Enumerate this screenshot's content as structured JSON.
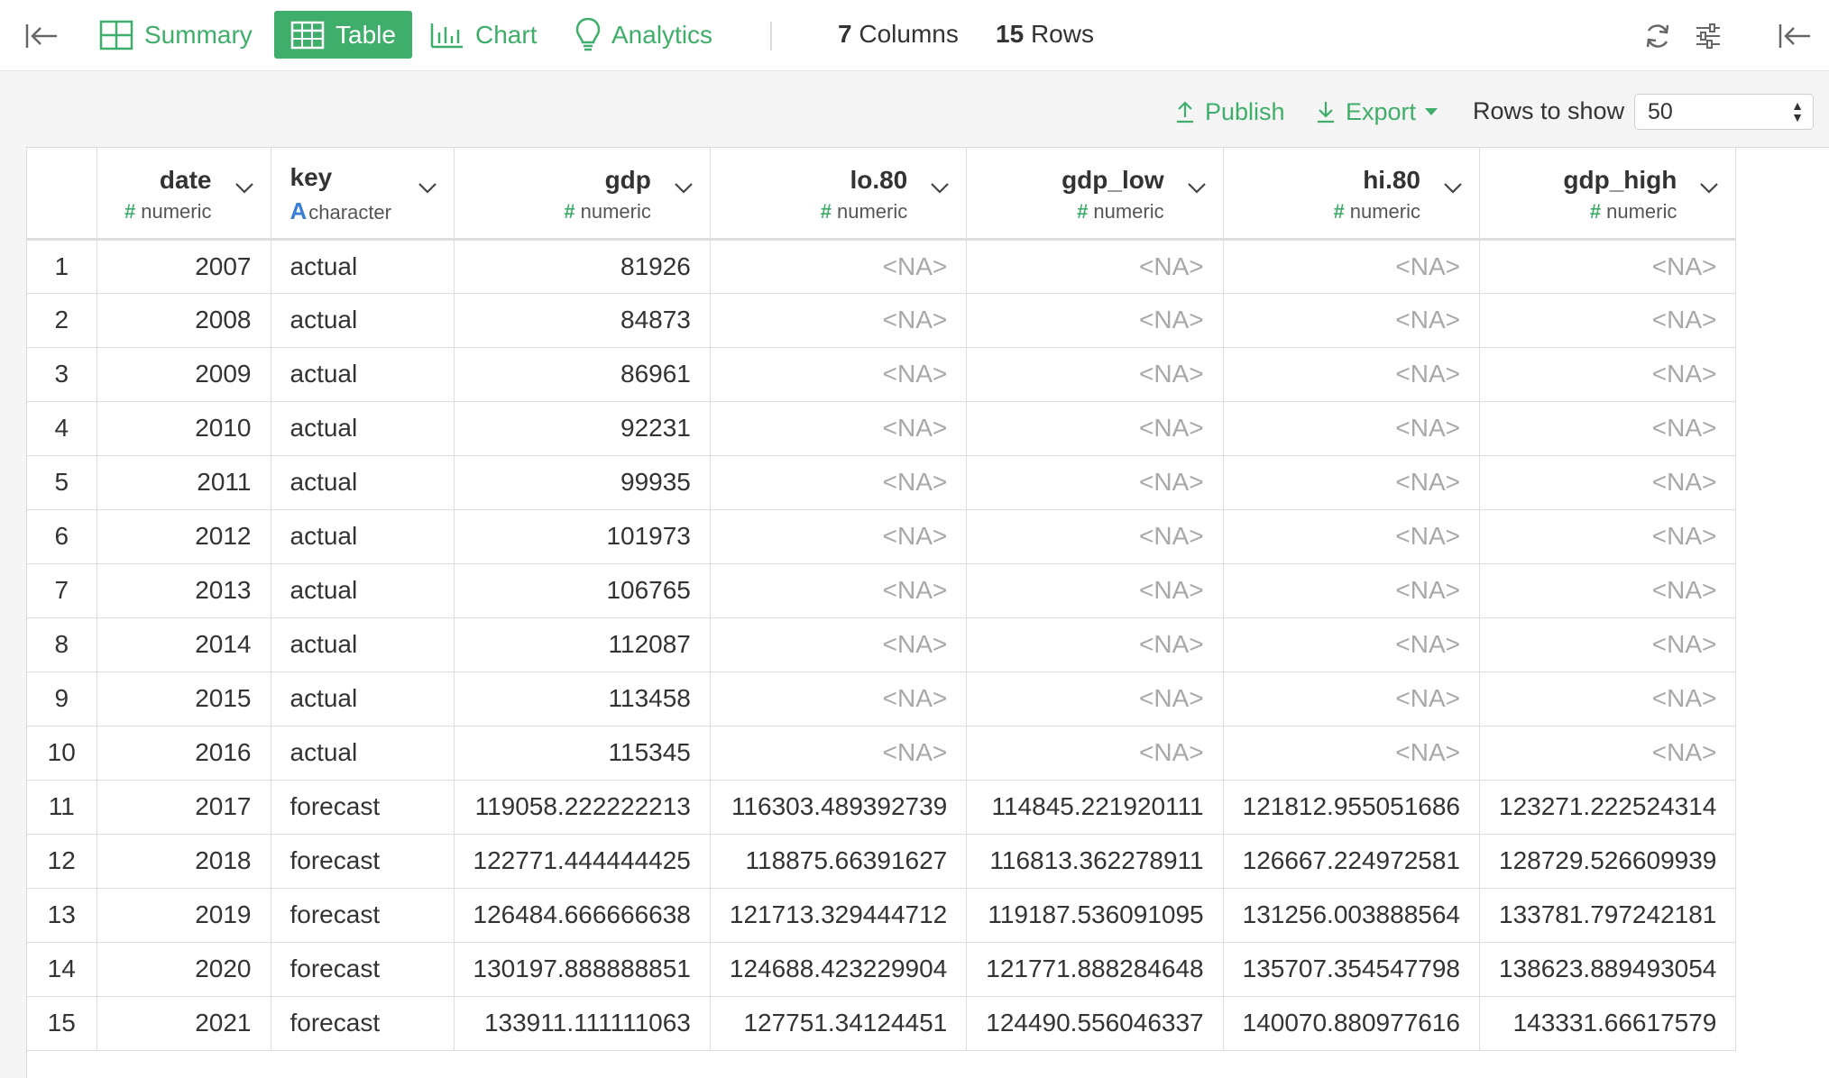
{
  "toolbar": {
    "tabs": [
      {
        "label": "Summary",
        "icon": "summary-grid-icon"
      },
      {
        "label": "Table",
        "icon": "table-icon",
        "active": true
      },
      {
        "label": "Chart",
        "icon": "bar-chart-icon"
      },
      {
        "label": "Analytics",
        "icon": "lightbulb-icon"
      }
    ],
    "columns_count": "7",
    "columns_label": "Columns",
    "rows_count": "15",
    "rows_label": "Rows"
  },
  "actions": {
    "publish_label": "Publish",
    "export_label": "Export",
    "rows_to_show_label": "Rows to show",
    "rows_to_show_value": "50"
  },
  "colors": {
    "accent": "#3fae6a",
    "character_type": "#3a7fd5",
    "na_text": "#a8a8a8"
  },
  "table": {
    "columns": [
      {
        "name": "date",
        "type": "numeric",
        "type_icon": "#",
        "align": "right"
      },
      {
        "name": "key",
        "type": "character",
        "type_icon": "A",
        "align": "left"
      },
      {
        "name": "gdp",
        "type": "numeric",
        "type_icon": "#",
        "align": "right"
      },
      {
        "name": "lo.80",
        "type": "numeric",
        "type_icon": "#",
        "align": "right"
      },
      {
        "name": "gdp_low",
        "type": "numeric",
        "type_icon": "#",
        "align": "right"
      },
      {
        "name": "hi.80",
        "type": "numeric",
        "type_icon": "#",
        "align": "right"
      },
      {
        "name": "gdp_high",
        "type": "numeric",
        "type_icon": "#",
        "align": "right"
      }
    ],
    "rows": [
      [
        "1",
        "2007",
        "actual",
        "81926",
        "<NA>",
        "<NA>",
        "<NA>",
        "<NA>"
      ],
      [
        "2",
        "2008",
        "actual",
        "84873",
        "<NA>",
        "<NA>",
        "<NA>",
        "<NA>"
      ],
      [
        "3",
        "2009",
        "actual",
        "86961",
        "<NA>",
        "<NA>",
        "<NA>",
        "<NA>"
      ],
      [
        "4",
        "2010",
        "actual",
        "92231",
        "<NA>",
        "<NA>",
        "<NA>",
        "<NA>"
      ],
      [
        "5",
        "2011",
        "actual",
        "99935",
        "<NA>",
        "<NA>",
        "<NA>",
        "<NA>"
      ],
      [
        "6",
        "2012",
        "actual",
        "101973",
        "<NA>",
        "<NA>",
        "<NA>",
        "<NA>"
      ],
      [
        "7",
        "2013",
        "actual",
        "106765",
        "<NA>",
        "<NA>",
        "<NA>",
        "<NA>"
      ],
      [
        "8",
        "2014",
        "actual",
        "112087",
        "<NA>",
        "<NA>",
        "<NA>",
        "<NA>"
      ],
      [
        "9",
        "2015",
        "actual",
        "113458",
        "<NA>",
        "<NA>",
        "<NA>",
        "<NA>"
      ],
      [
        "10",
        "2016",
        "actual",
        "115345",
        "<NA>",
        "<NA>",
        "<NA>",
        "<NA>"
      ],
      [
        "11",
        "2017",
        "forecast",
        "119058.222222213",
        "116303.489392739",
        "114845.221920111",
        "121812.955051686",
        "123271.222524314"
      ],
      [
        "12",
        "2018",
        "forecast",
        "122771.444444425",
        "118875.66391627",
        "116813.362278911",
        "126667.224972581",
        "128729.526609939"
      ],
      [
        "13",
        "2019",
        "forecast",
        "126484.666666638",
        "121713.329444712",
        "119187.536091095",
        "131256.003888564",
        "133781.797242181"
      ],
      [
        "14",
        "2020",
        "forecast",
        "130197.888888851",
        "124688.423229904",
        "121771.888284648",
        "135707.354547798",
        "138623.889493054"
      ],
      [
        "15",
        "2021",
        "forecast",
        "133911.111111063",
        "127751.34124451",
        "124490.556046337",
        "140070.880977616",
        "143331.66617579"
      ]
    ]
  }
}
